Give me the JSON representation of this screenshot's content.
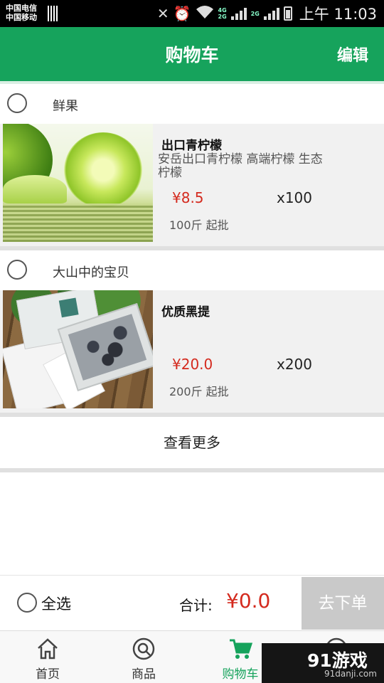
{
  "status_bar": {
    "carrier_1": "中国电信",
    "carrier_2": "中国移动",
    "net_top": "4G",
    "net_bottom": "2G",
    "net_2": "2G",
    "time": "上午 11:03"
  },
  "header": {
    "title": "购物车",
    "edit_label": "编辑"
  },
  "shops": [
    {
      "name": "鲜果",
      "item": {
        "title": "出口青柠檬",
        "description": "安岳出口青柠檬 高端柠檬 生态柠檬",
        "price": "¥8.5",
        "quantity": "x100",
        "min_order": "100斤 起批"
      }
    },
    {
      "name": "大山中的宝贝",
      "item": {
        "title": "优质黑提",
        "description": "",
        "price": "¥20.0",
        "quantity": "x200",
        "min_order": "200斤 起批"
      }
    }
  ],
  "more_label": "查看更多",
  "summary": {
    "select_all_label": "全选",
    "total_label": "合计:",
    "total_value": "¥0.0",
    "checkout_label": "去下单"
  },
  "bottom_nav": {
    "items": [
      {
        "label": "首页",
        "icon": "home-icon"
      },
      {
        "label": "商品",
        "icon": "search-icon"
      },
      {
        "label": "购物车",
        "icon": "cart-icon"
      }
    ]
  },
  "watermark": {
    "logo": "91游戏",
    "url": "91danji.com"
  },
  "colors": {
    "brand_green": "#16a35c",
    "price_red": "#d42a1e",
    "checkout_disabled": "#c9c9c9"
  }
}
